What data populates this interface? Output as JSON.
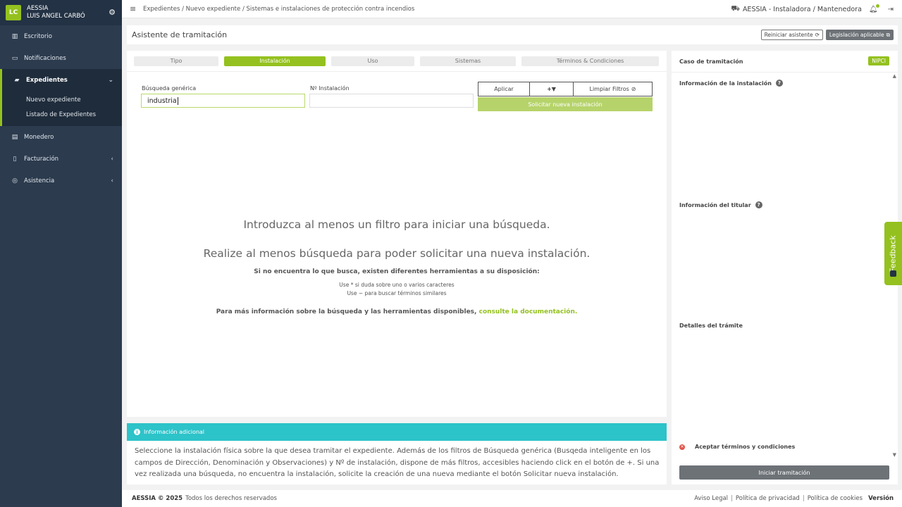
{
  "sidebar": {
    "avatar": "LC",
    "org": "AESSIA",
    "user": "LUIS ANGEL CARBÓ",
    "items": [
      {
        "label": "Escritorio",
        "icon": "chart-icon"
      },
      {
        "label": "Notificaciones",
        "icon": "inbox-icon"
      },
      {
        "label": "Expedientes",
        "icon": "folder-icon"
      },
      {
        "label": "Monedero",
        "icon": "wallet-icon"
      },
      {
        "label": "Facturación",
        "icon": "file-icon"
      },
      {
        "label": "Asistencia",
        "icon": "support-icon"
      }
    ],
    "sub_items": [
      "Nuevo expediente",
      "Listado de Expedientes"
    ]
  },
  "topbar": {
    "breadcrumb": "Expedientes / Nuevo expediente / Sistemas e instalaciones de protección contra incendios",
    "org": "AESSIA - Instaladora / Mantenedora"
  },
  "header": {
    "title": "Asistente de tramitación",
    "reset_label": "Reiniciar asistente",
    "legislation_label": "Legislación aplicable"
  },
  "tabs": [
    "Tipo",
    "Instalación",
    "Uso",
    "Sistemas",
    "Términos & Condiciones"
  ],
  "search": {
    "generic_label": "Búsqueda genérica",
    "generic_value": "industria",
    "number_label": "Nº Instalación",
    "number_value": "",
    "apply_label": "Aplicar",
    "more_filters_label": "+",
    "clear_label": "Limpiar Filtros",
    "request_label": "Solicitar nueva instalación"
  },
  "empty_state": {
    "line1": "Introduzca al menos un filtro para iniciar una búsqueda.",
    "line2": "Realize al menos búsqueda para poder solicitar una nueva instalación.",
    "tools_title": "Si no encuentra lo que busca, existen diferentes herramientas a su disposición:",
    "tip1": "Use * si duda sobre uno o varios caracteres",
    "tip2": "Use ~ para buscar términos similares",
    "more_info": "Para más información sobre la búsqueda y las herramientas disponibles,",
    "doc_link": "consulte la documentación."
  },
  "info": {
    "title": "Información adicional",
    "body": "Seleccione la instalación física sobre la que desea tramitar el expediente. Además de los filtros de Búsqueda genérica (Busqeda inteligente en los campos de Dirección, Denominación y Observaciones) y Nº de instalación, dispone de más filtros, accesibles haciendo click en el botón de +. Si una vez realizada una búsqueda, no encuentra la instalación, solicite la creación de una nueva mediante el botón Solicitar nueva instalación."
  },
  "right_panel": {
    "case_label": "Caso de tramitación",
    "case_badge": "NIPCI",
    "installation_info": "Información de la instalación",
    "holder_info": "Información del titular",
    "details": "Detalles del trámite",
    "terms": "Aceptar términos y condiciones",
    "start_label": "Iniciar tramitación"
  },
  "feedback": "Feedback",
  "footer": {
    "brand": "AESSIA © 2025",
    "rights": "Todos los derechos reservados",
    "links": [
      "Aviso Legal",
      "Política de privacidad",
      "Política de cookies"
    ],
    "version": "Versión"
  }
}
